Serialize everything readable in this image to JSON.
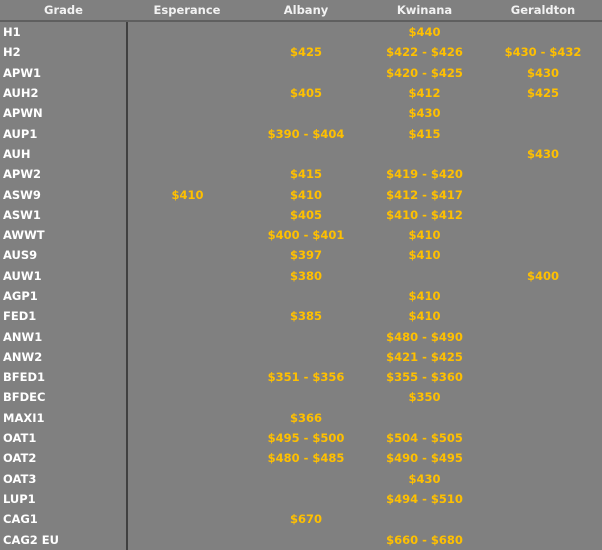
{
  "headers": [
    "Grade",
    "Esperance",
    "Albany",
    "Kwinana",
    "Geraldton"
  ],
  "rows": [
    [
      "H1",
      "",
      "",
      "$440",
      ""
    ],
    [
      "H2",
      "",
      "$425",
      "$422 - $426",
      "$430 - $432"
    ],
    [
      "APW1",
      "",
      "",
      "$420 - $425",
      "$430"
    ],
    [
      "AUH2",
      "",
      "$405",
      "$412",
      "$425"
    ],
    [
      "APWN",
      "",
      "",
      "$430",
      ""
    ],
    [
      "AUP1",
      "",
      "$390 - $404",
      "$415",
      ""
    ],
    [
      "AUH",
      "",
      "",
      "",
      "$430"
    ],
    [
      "APW2",
      "",
      "$415",
      "$419 - $420",
      ""
    ],
    [
      "ASW9",
      "$410",
      "$410",
      "$412 - $417",
      ""
    ],
    [
      "ASW1",
      "",
      "$405",
      "$410 - $412",
      ""
    ],
    [
      "AWWT",
      "",
      "$400 - $401",
      "$410",
      ""
    ],
    [
      "AUS9",
      "",
      "$397",
      "$410",
      ""
    ],
    [
      "AUW1",
      "",
      "$380",
      "",
      "$400"
    ],
    [
      "AGP1",
      "",
      "",
      "$410",
      ""
    ],
    [
      "FED1",
      "",
      "$385",
      "$410",
      ""
    ],
    [
      "ANW1",
      "",
      "",
      "$480 - $490",
      ""
    ],
    [
      "ANW2",
      "",
      "",
      "$421 - $425",
      ""
    ],
    [
      "BFED1",
      "",
      "$351 - $356",
      "$355 - $360",
      ""
    ],
    [
      "BFDEC",
      "",
      "",
      "$350",
      ""
    ],
    [
      "MAXI1",
      "",
      "$366",
      "",
      ""
    ],
    [
      "OAT1",
      "",
      "$495 - $500",
      "$504 - $505",
      ""
    ],
    [
      "OAT2",
      "",
      "$480 - $485",
      "$490 - $495",
      ""
    ],
    [
      "OAT3",
      "",
      "",
      "$430",
      ""
    ],
    [
      "LUP1",
      "",
      "",
      "$494 - $510",
      ""
    ],
    [
      "CAG1",
      "",
      "$670",
      "",
      ""
    ],
    [
      "CAG2 EU",
      "",
      "",
      "$660 - $680",
      ""
    ]
  ],
  "colors": {
    "background": "#808080",
    "price": "#ffc000",
    "label": "#ffffff"
  }
}
